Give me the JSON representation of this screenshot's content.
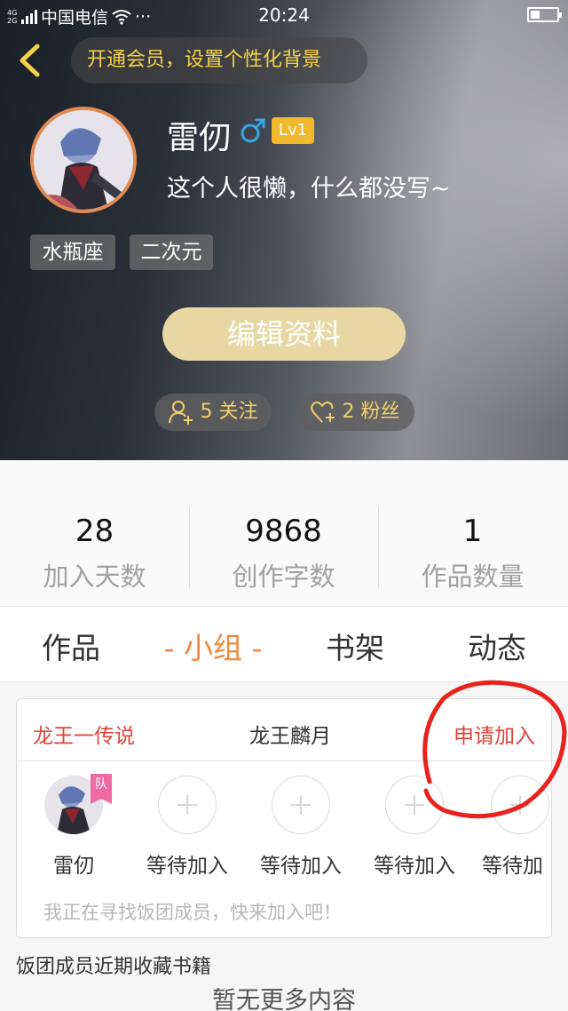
{
  "status_bar": {
    "network_top": "4G",
    "network_bottom": "2G",
    "carrier": "中国电信",
    "more": "···",
    "time": "20:24"
  },
  "header": {
    "vip_prompt": "开通会员，设置个性化背景"
  },
  "profile": {
    "username": "雷仞",
    "gender_symbol": "♂",
    "level": "Lv1",
    "bio": "这个人很懒，什么都没写~",
    "tags": [
      "水瓶座",
      "二次元"
    ],
    "edit_label": "编辑资料",
    "following": "5 关注",
    "followers": "2 粉丝"
  },
  "stats": [
    {
      "value": "28",
      "label": "加入天数"
    },
    {
      "value": "9868",
      "label": "创作字数"
    },
    {
      "value": "1",
      "label": "作品数量"
    }
  ],
  "tabs": [
    {
      "label": "作品"
    },
    {
      "label": "- 小组 -"
    },
    {
      "label": "书架"
    },
    {
      "label": "动态"
    }
  ],
  "group": {
    "left_label": "龙王一传说",
    "name": "龙王麟月",
    "apply_label": "申请加入",
    "team_badge": "队",
    "members": [
      "雷仞",
      "等待加入",
      "等待加入",
      "等待加入",
      "等待加"
    ],
    "hint": "我正在寻找饭团成员，快来加入吧！"
  },
  "collect_title": "饭团成员近期收藏书籍",
  "no_more": "暂无更多内容",
  "colors": {
    "accent_orange": "#f0883e",
    "red": "#e0433a",
    "gold": "#f5d14a",
    "level_badge": "#f3b92e",
    "edit_button": "#e7d8a3",
    "annotation_circle": "#e8231e"
  }
}
